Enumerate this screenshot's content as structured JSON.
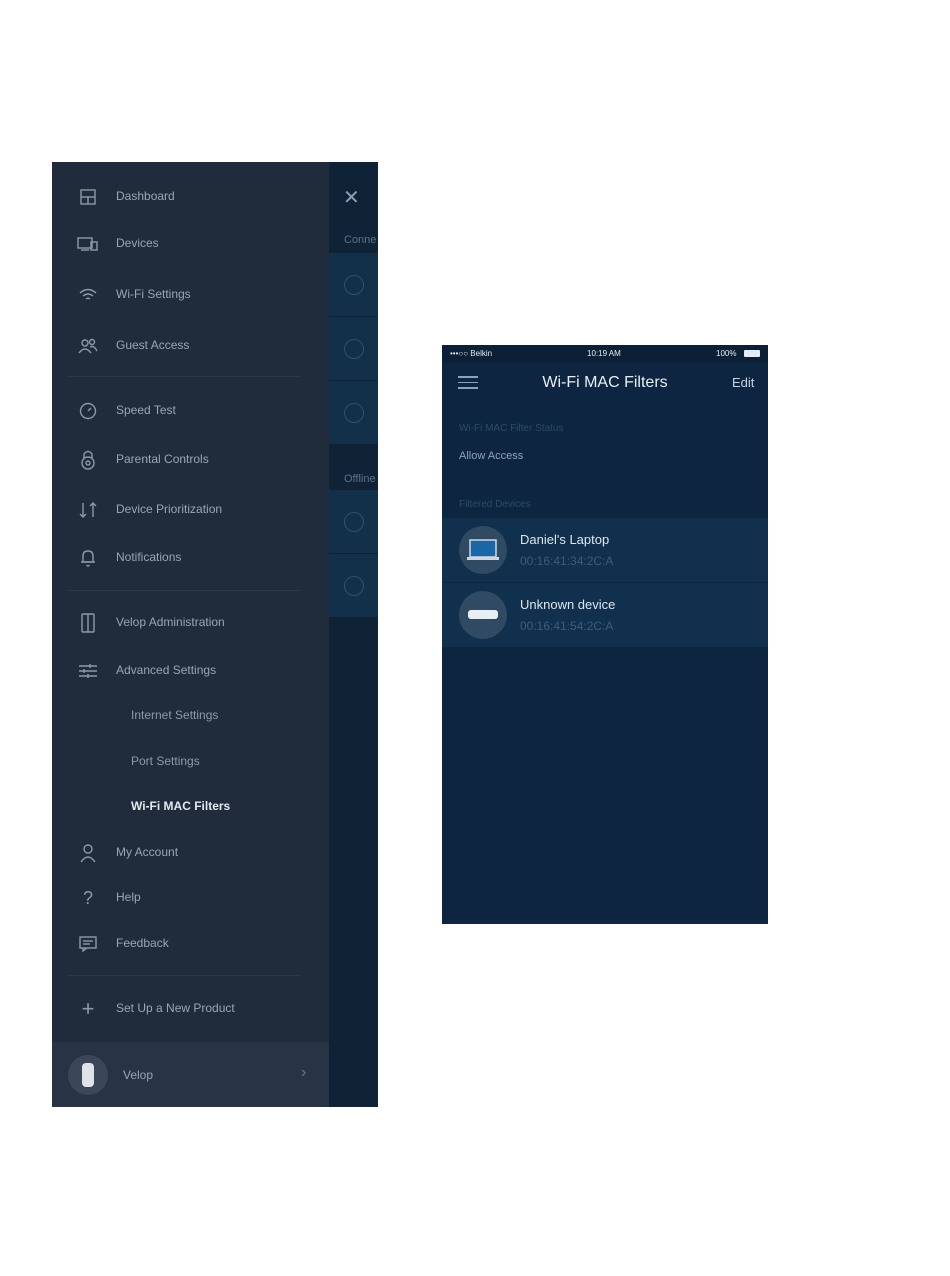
{
  "left_screen": {
    "behind_panel": {
      "section_connected": "Conne",
      "section_offline": "Offline"
    },
    "nav": {
      "dashboard": "Dashboard",
      "devices": "Devices",
      "wifi_settings": "Wi-Fi Settings",
      "guest_access": "Guest Access",
      "speed_test": "Speed Test",
      "parental_controls": "Parental Controls",
      "device_prioritization": "Device Prioritization",
      "notifications": "Notifications",
      "velop_administration": "Velop Administration",
      "advanced_settings": "Advanced Settings",
      "internet_settings": "Internet Settings",
      "port_settings": "Port Settings",
      "wifi_mac_filters": "Wi-Fi MAC Filters",
      "my_account": "My Account",
      "help": "Help",
      "feedback": "Feedback",
      "set_up_new_product": "Set Up a New Product"
    },
    "footer": {
      "label": "Velop"
    }
  },
  "right_screen": {
    "statusbar": {
      "carrier": "•••○○ Belkin",
      "time": "10:19 AM",
      "battery": "100%"
    },
    "title": "Wi-Fi MAC Filters",
    "edit_label": "Edit",
    "status_label": "Wi-Fi MAC Filter Status",
    "status_value": "Allow Access",
    "filtered_label": "Filtered Devices",
    "devices": [
      {
        "name": "Daniel's Laptop",
        "mac": "00:16:41:34:2C:A"
      },
      {
        "name": "Unknown device",
        "mac": "00:16:41:54:2C:A"
      }
    ]
  }
}
